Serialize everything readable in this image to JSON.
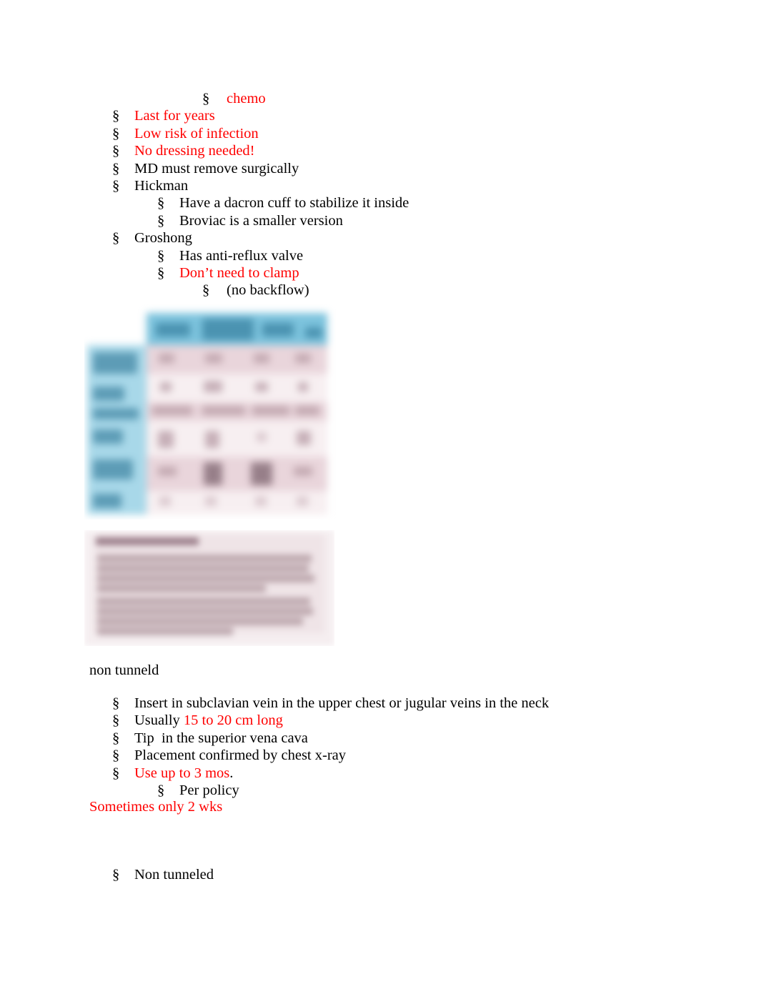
{
  "document": {
    "colors": {
      "highlight_red": "#ff0000",
      "body_text": "#000000",
      "table_header_blue": "#7cc3dd",
      "table_side_blue": "#a8d8e9",
      "table_row_pink": "#e9d5db",
      "table_row_white": "#f7eff1",
      "paragraph_image_bg": "#f5eef0"
    },
    "bullet_marker": "§",
    "outline": [
      {
        "level": 3,
        "marker": "§",
        "text": "chemo",
        "color": "red"
      },
      {
        "level": 1,
        "marker": "§",
        "text": "Last for years",
        "color": "red"
      },
      {
        "level": 1,
        "marker": "§",
        "text": "Low risk of infection",
        "color": "red"
      },
      {
        "level": 1,
        "marker": "§",
        "text": "No dressing needed!",
        "color": "red"
      },
      {
        "level": 1,
        "marker": "§",
        "text": "MD must remove surgically",
        "color": "black"
      },
      {
        "level": 1,
        "marker": "§",
        "text": "Hickman",
        "color": "black"
      },
      {
        "level": 2,
        "marker": "§",
        "text": "Have a dacron cuff to stabilize it inside",
        "color": "black"
      },
      {
        "level": 2,
        "marker": "§",
        "text": "Broviac is a smaller version",
        "color": "black"
      },
      {
        "level": 1,
        "marker": "§",
        "text": "Groshong",
        "color": "black"
      },
      {
        "level": 2,
        "marker": "§",
        "text": "Has anti-reflux valve",
        "color": "black"
      },
      {
        "level": 2,
        "marker": "§",
        "text": "Don’t need to clamp",
        "color": "red"
      },
      {
        "level": 3,
        "marker": "§",
        "text": "(no backflow)",
        "color": "black"
      }
    ],
    "section_heading": "non tunneld",
    "outline2": [
      {
        "level": 1,
        "marker": "§",
        "text": "Insert in subclavian vein in the upper chest or jugular veins in the neck",
        "color": "black"
      },
      {
        "level": 1,
        "marker": "§",
        "text_black": "Usually ",
        "text_red": "15 to 20 cm long"
      },
      {
        "level": 1,
        "marker": "§",
        "text": "Tip  in the superior vena cava",
        "color": "black"
      },
      {
        "level": 1,
        "marker": "§",
        "text": "Placement confirmed by chest x-ray",
        "color": "black"
      },
      {
        "level": 1,
        "marker": "§",
        "text_red": "Use up to 3 mos",
        "text_black": "."
      },
      {
        "level": 2,
        "marker": "§",
        "text": "Per policy",
        "color": "black"
      }
    ],
    "trailing_note": "Sometimes only 2 wks",
    "final_item": {
      "level": 1,
      "marker": "§",
      "text": "Non tunneled",
      "color": "black"
    },
    "images": [
      {
        "name": "catheter-comparison-table-image",
        "description": "Blurred screenshot of a comparison table with blue header row, blue left label column and alternating pink/white data rows",
        "columns": 4,
        "rows": 6
      },
      {
        "name": "catheter-notes-paragraph-image",
        "description": "Blurred screenshot of a pink-tinted text paragraph block with a heading line",
        "lines": 9
      }
    ]
  }
}
